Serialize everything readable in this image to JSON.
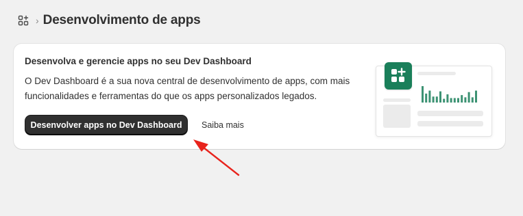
{
  "breadcrumb": {
    "root_icon": "apps-icon",
    "separator": "›",
    "title": "Desenvolvimento de apps"
  },
  "card": {
    "title": "Desenvolva e gerencie apps no seu Dev Dashboard",
    "description": "O Dev Dashboard é a sua nova central de desenvolvimento de apps, com mais funcionalidades e ferramentas do que os apps personalizados legados.",
    "primary_button": "Desenvolver apps no Dev Dashboard",
    "secondary_link": "Saiba mais"
  },
  "illustration": {
    "icon": "apps-icon",
    "accent_color": "#1a7f5a",
    "chart_bar_values": [
      22,
      12,
      16,
      8,
      8,
      15,
      5,
      11,
      6,
      6,
      6,
      10,
      7,
      14,
      7,
      16
    ]
  },
  "colors": {
    "background": "#f1f1f1",
    "primary_button": "#303030",
    "annotation_arrow": "#e8231c"
  }
}
